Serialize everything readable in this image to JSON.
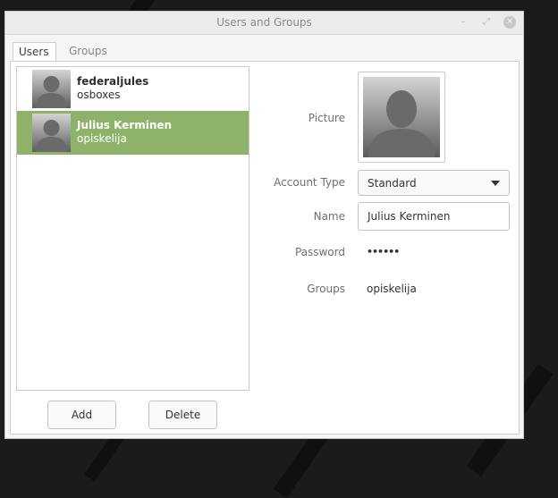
{
  "window": {
    "title": "Users and Groups"
  },
  "tabs": [
    {
      "label": "Users",
      "active": true
    },
    {
      "label": "Groups",
      "active": false
    }
  ],
  "users": [
    {
      "name": "federaljules",
      "login": "osboxes",
      "selected": false
    },
    {
      "name": "Julius Kerminen",
      "login": "opiskelija",
      "selected": true
    }
  ],
  "buttons": {
    "add": "Add",
    "delete": "Delete"
  },
  "details": {
    "picture_label": "Picture",
    "account_type_label": "Account Type",
    "account_type_value": "Standard",
    "name_label": "Name",
    "name_value": "Julius Kerminen",
    "password_label": "Password",
    "password_value": "••••••",
    "groups_label": "Groups",
    "groups_value": "opiskelija"
  },
  "colors": {
    "selection": "#8fb26b",
    "window_bg": "#f5f5f5",
    "desktop_bg": "#1b1b1b"
  }
}
